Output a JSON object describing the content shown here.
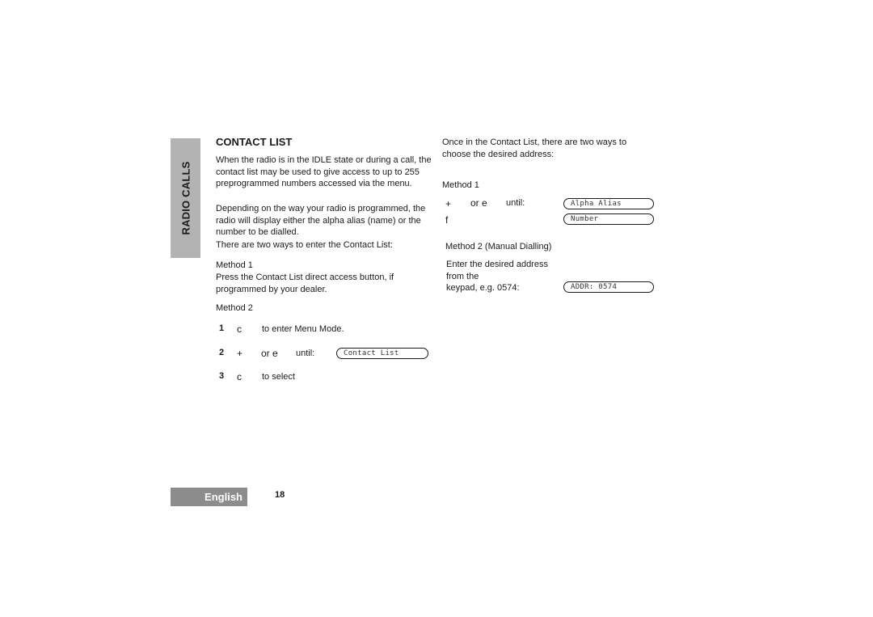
{
  "side_tab": {
    "label": "RADIO CALLS"
  },
  "left_column": {
    "heading": "CONTACT LIST",
    "paragraphs": [
      "When the radio is in the IDLE state or during a call, the contact list may be used to give access to up to 255 preprogrammed numbers accessed via the menu.",
      "Depending on the way your radio is programmed, the radio will display either the alpha alias (name) or the number to be dialled.",
      "There are two ways to enter the Contact List:"
    ],
    "method1": {
      "title": "Method 1",
      "text": "Press the Contact List direct access button, if programmed by your dealer."
    },
    "method2": {
      "title": "Method 2",
      "steps": [
        {
          "num": "1",
          "key": "c",
          "text": "to enter Menu Mode.",
          "display": ""
        },
        {
          "num": "2",
          "key": "+",
          "alt": "or e",
          "text": "until:",
          "display": "Contact List"
        },
        {
          "num": "3",
          "key": "c",
          "text": "to select",
          "display": ""
        }
      ]
    }
  },
  "right_column": {
    "intro": "Once in the Contact List, there are two ways to choose the desired address:",
    "method1": {
      "title": "Method 1",
      "rows": [
        {
          "key": "+",
          "alt": "or e",
          "text": "until:",
          "display": "Alpha Alias"
        },
        {
          "key": "f",
          "alt": "",
          "text": "",
          "display": "Number"
        }
      ]
    },
    "method2": {
      "title": "Method 2 (Manual Dialling)",
      "text_lines": [
        "Enter the desired address",
        "from the",
        "keypad, e.g. 0574:"
      ],
      "display": "ADDR: 0574"
    }
  },
  "footer": {
    "language": "English",
    "page_number": "18"
  },
  "colors": {
    "side_tab_bg": "#b3b3b3",
    "footer_tab_bg": "#8c8c8c"
  }
}
